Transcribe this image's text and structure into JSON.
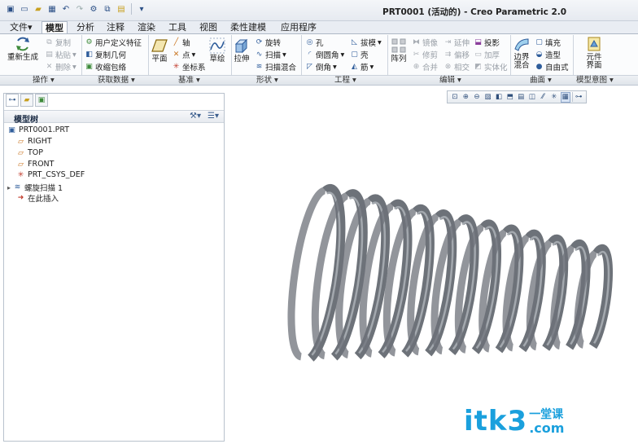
{
  "window": {
    "title": "PRT0001 (活动的) - Creo Parametric 2.0"
  },
  "ribbon_tabs": [
    "文件",
    "模型",
    "分析",
    "注释",
    "渲染",
    "工具",
    "视图",
    "柔性建模",
    "应用程序"
  ],
  "ribbon": {
    "regenerate": "重新生成",
    "copy": "复制",
    "paste": "粘贴",
    "delete": "删除",
    "udf": "用户定义特征",
    "copy_geometry": "复制几何",
    "shrinkwrap": "收缩包络",
    "plane": "平面",
    "axis": "轴",
    "point": "点",
    "csys": "坐标系",
    "sketch": "草绘",
    "extrude": "拉伸",
    "revolve": "旋转",
    "sweep": "扫描",
    "swept_blend": "扫描混合",
    "hole": "孔",
    "round": "倒圆角",
    "chamfer": "倒角",
    "draft": "拔模",
    "shell": "壳",
    "rib": "筋",
    "pattern": "阵列",
    "mirror": "镜像",
    "trim": "修剪",
    "merge": "合并",
    "extend": "延伸",
    "offset": "偏移",
    "intersect": "相交",
    "project": "投影",
    "thicken": "加厚",
    "solidify": "实体化",
    "boundary_blend_1": "边界",
    "boundary_blend_2": "混合",
    "fill": "填充",
    "style": "造型",
    "freestyle": "自由式",
    "component_interface_1": "元件",
    "component_interface_2": "界面"
  },
  "groups": [
    "操作",
    "获取数据",
    "基准",
    "形状",
    "工程",
    "编辑",
    "曲面",
    "模型意图"
  ],
  "model_tree": {
    "title": "模型树",
    "items": [
      {
        "label": "PRT0001.PRT",
        "icon": "part-icon"
      },
      {
        "label": "RIGHT",
        "icon": "datum-plane-icon"
      },
      {
        "label": "TOP",
        "icon": "datum-plane-icon"
      },
      {
        "label": "FRONT",
        "icon": "datum-plane-icon"
      },
      {
        "label": "PRT_CSYS_DEF",
        "icon": "csys-icon"
      },
      {
        "label": "螺旋扫描 1",
        "icon": "helical-sweep-icon"
      },
      {
        "label": "在此插入",
        "icon": "insert-here-icon"
      }
    ]
  },
  "watermark": {
    "main": "itk3",
    "top": "一堂课",
    "bottom": ".com"
  },
  "colors": {
    "spring": "#6d7279",
    "watermark": "#1aa0dd"
  }
}
